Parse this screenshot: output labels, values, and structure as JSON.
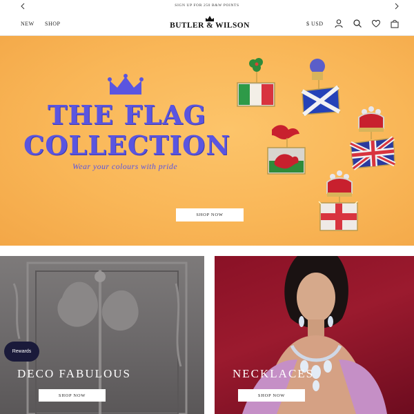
{
  "announcement": {
    "message": "SIGN UP FOR 250 B&W POINTS",
    "prev_icon": "chevron-left-icon",
    "next_icon": "chevron-right-icon"
  },
  "header": {
    "nav": {
      "new_label": "NEW",
      "shop_label": "SHOP"
    },
    "logo_text": "BUTLER & WILSON",
    "currency": "$ USD",
    "icons": [
      "account-icon",
      "search-icon",
      "heart-icon",
      "bag-icon"
    ]
  },
  "hero": {
    "title_line1": "THE FLAG",
    "title_line2": "COLLECTION",
    "tagline": "Wear your colours with pride",
    "button_label": "SHOP NOW",
    "colors": {
      "background": "#f9b657",
      "title": "#5a55e0"
    }
  },
  "cards": [
    {
      "title": "DECO FABULOUS",
      "button_label": "SHOP NOW"
    },
    {
      "title": "NECKLACES",
      "button_label": "SHOP NOW"
    }
  ],
  "rewards_label": "Rewards"
}
